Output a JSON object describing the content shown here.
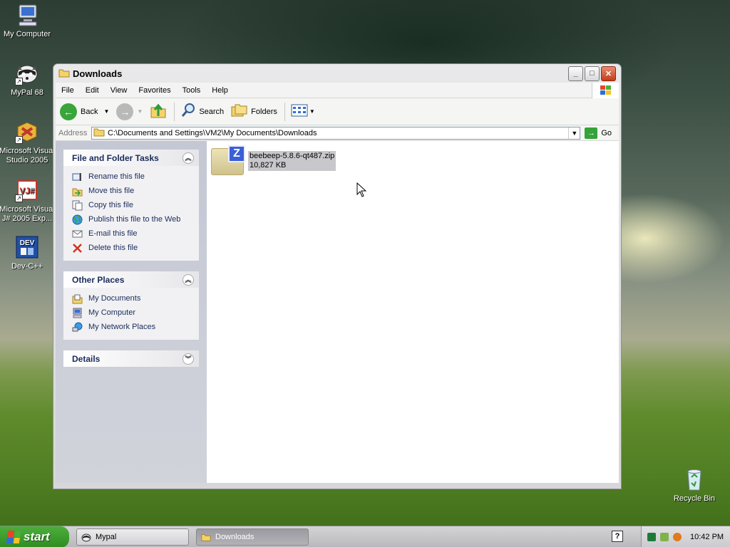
{
  "desktop": {
    "icons": [
      {
        "label": "My Computer"
      },
      {
        "label": "MyPal 68"
      },
      {
        "label": "Microsoft Visual Studio 2005"
      },
      {
        "label": "Microsoft Visual J# 2005 Exp..."
      },
      {
        "label": "Dev-C++"
      },
      {
        "label": "Recycle Bin"
      }
    ]
  },
  "window": {
    "title": "Downloads",
    "menu": [
      "File",
      "Edit",
      "View",
      "Favorites",
      "Tools",
      "Help"
    ],
    "toolbar": {
      "back": "Back",
      "search": "Search",
      "folders": "Folders"
    },
    "address": {
      "label": "Address",
      "value": "C:\\Documents and Settings\\VM2\\My Documents\\Downloads",
      "go": "Go"
    },
    "tasks": {
      "file_folder": {
        "title": "File and Folder Tasks",
        "items": [
          "Rename this file",
          "Move this file",
          "Copy this file",
          "Publish this file to the Web",
          "E-mail this file",
          "Delete this file"
        ]
      },
      "other_places": {
        "title": "Other Places",
        "items": [
          "My Documents",
          "My Computer",
          "My Network Places"
        ]
      },
      "details": {
        "title": "Details"
      }
    },
    "files": [
      {
        "name": "beebeep-5.8.6-qt487.zip",
        "size": "10,827 KB",
        "selected": true
      }
    ]
  },
  "taskbar": {
    "start": "start",
    "buttons": [
      {
        "label": "Mypal",
        "active": false
      },
      {
        "label": "Downloads",
        "active": true
      }
    ],
    "clock": "10:42 PM"
  }
}
